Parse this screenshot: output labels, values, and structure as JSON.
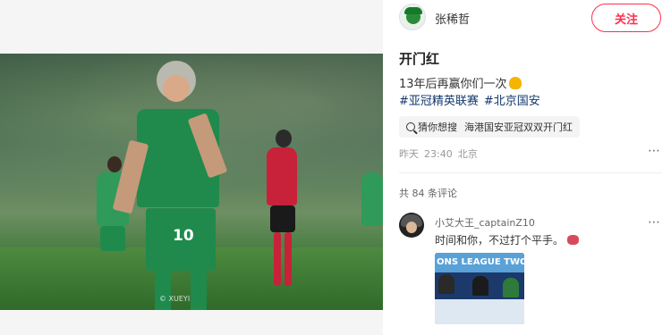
{
  "post": {
    "username": "张稀哲",
    "follow_label": "关注",
    "title": "开门红",
    "body": "13年后再赢你们一次",
    "tags": [
      "#亚冠精英联赛",
      "#北京国安"
    ],
    "guess_label": "猜你想搜",
    "guess_query": "海港国安亚冠双双开门红",
    "time_day": "昨天",
    "time_clock": "23:40",
    "location": "北京",
    "more_icon": "⋯"
  },
  "photo": {
    "jersey_number": "10",
    "watermark": "© XUEYI"
  },
  "comments": {
    "count_label": "共 84 条评论",
    "items": [
      {
        "name": "小艾大王_captainZ10",
        "text": "时间和你，不过打个平手。",
        "image_banner": "ONS LEAGUE TWO"
      }
    ]
  },
  "colors": {
    "accent": "#ff2e4d",
    "tag": "#13386c",
    "jersey": "#1f8a4c"
  }
}
